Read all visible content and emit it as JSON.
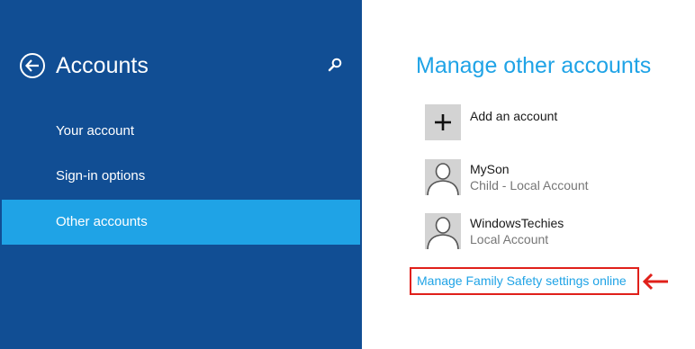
{
  "sidebar": {
    "title": "Accounts",
    "items": [
      {
        "label": "Your account"
      },
      {
        "label": "Sign-in options"
      },
      {
        "label": "Other accounts"
      }
    ]
  },
  "main": {
    "title": "Manage other accounts",
    "add_account_label": "Add an account",
    "accounts": [
      {
        "name": "MySon",
        "type": "Child - Local Account"
      },
      {
        "name": "WindowsTechies",
        "type": "Local Account"
      }
    ],
    "family_safety_link": "Manage Family Safety settings online"
  },
  "colors": {
    "sidebar_bg": "#114E94",
    "accent": "#1FA3E6",
    "highlight_border": "#E0201A"
  },
  "icons": [
    "back-arrow-icon",
    "search-icon",
    "plus-icon",
    "user-avatar-icon",
    "red-arrow-annotation-icon"
  ]
}
